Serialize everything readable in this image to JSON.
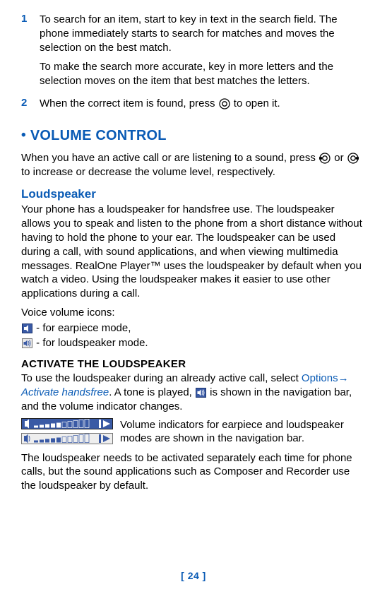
{
  "steps": [
    {
      "number": "1",
      "text_a": " To search for an item, start to key in text in the search field. The phone immediately starts to search for matches and moves the selection on the best match.",
      "text_b": "To make the search more accurate, key in more letters and the selection moves on the item that best matches the letters."
    },
    {
      "number": "2",
      "text_prefix": "When the correct item is found, press ",
      "text_suffix": " to open it."
    }
  ],
  "volume_control": {
    "heading": "VOLUME CONTROL",
    "intro_a": "When you have an active call or are listening to a sound, press ",
    "intro_mid": " or ",
    "intro_b": " to increase or decrease the volume level, respectively."
  },
  "loudspeaker": {
    "heading": "Loudspeaker",
    "para": "Your phone has a loudspeaker for handsfree use. The loudspeaker allows you to speak and listen to the phone from a short distance without having to hold the phone to your ear.  The loudspeaker can be used during a call, with sound applications, and when viewing multimedia messages. RealOne Player™ uses the loudspeaker by default when you watch a video. Using the loudspeaker makes it easier to use other applications during a call.",
    "voice_icons_label": "Voice volume icons:",
    "earpiece_text": " - for earpiece mode,",
    "loudspeaker_text": " - for loudspeaker mode."
  },
  "activate": {
    "heading": "ACTIVATE THE LOUDSPEAKER",
    "p1_prefix": "To use the loudspeaker during an already active call, select ",
    "option1": "Options",
    "arrow": "→ ",
    "option2": "Activate handsfree",
    "p1_mid": ". A tone is played, ",
    "p1_suffix": " is shown in the navigation bar, and the volume indicator changes.",
    "figure_caption": "Volume indicators for earpiece and loudspeaker modes are shown in the navigation bar.",
    "p2": "The loudspeaker needs to be activated separately each time for phone calls, but the sound applications such as Composer and Recorder use the loudspeaker by default."
  },
  "page_number": "[ 24 ]"
}
